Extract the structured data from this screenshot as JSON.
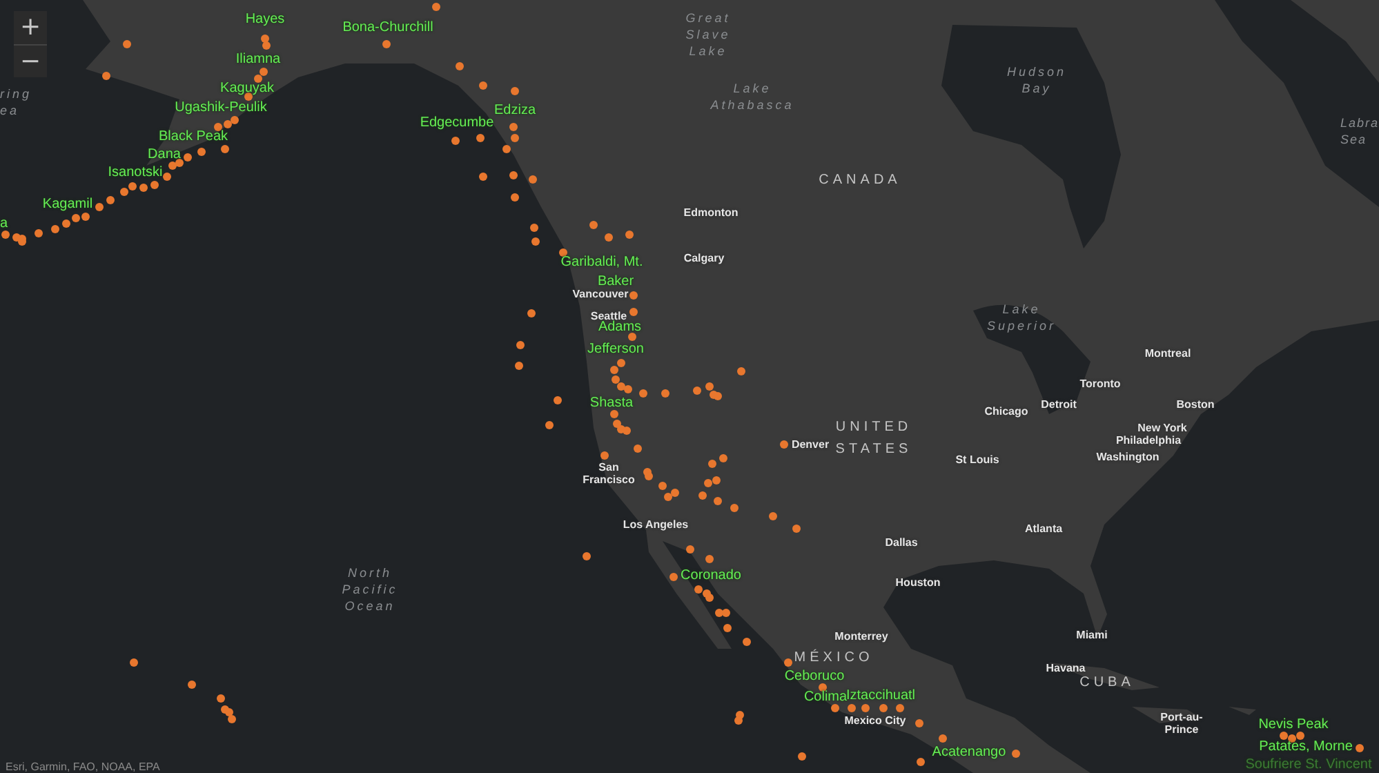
{
  "zoom_controls": [
    {
      "kind": "zoom-in",
      "symbol": "+"
    },
    {
      "kind": "zoom-out",
      "symbol": "−"
    }
  ],
  "volcano_labels": [
    "Hayes",
    "Bona-Churchill",
    "Iliamna",
    "Kaguyak",
    "Ugashik-Peulik",
    "Black Peak",
    "Dana",
    "Isanotski",
    "Kagamil",
    "a",
    "Edgecumbe",
    "Edziza",
    "Garibaldi, Mt.",
    "Baker",
    "Adams",
    "Jefferson",
    "Shasta",
    "Coronado",
    "Ceboruco",
    "Colima",
    "Iztaccihuatl",
    "Acatenango",
    "Nevis Peak",
    "Patates, Morne",
    "Soufriere St. Vincent"
  ],
  "city_labels": [
    "Edmonton",
    "Calgary",
    "Vancouver",
    "Seattle",
    "San\nFrancisco",
    "Los Angeles",
    "Denver",
    "Chicago",
    "St Louis",
    "Detroit",
    "Toronto",
    "Montreal",
    "Boston",
    "New York",
    "Philadelphia",
    "Washington",
    "Atlanta",
    "Dallas",
    "Houston",
    "Monterrey",
    "Miami",
    "Havana",
    "Mexico City",
    "Port-au-\nPrince"
  ],
  "country_labels": [
    "CANADA",
    "UNITED\nSTATES",
    "MÉXICO",
    "CUBA"
  ],
  "water_labels": [
    "ring\nea",
    "Great\nSlave\nLake",
    "Lake\nAthabasca",
    "Hudson\nBay",
    "Labra\nSea",
    "Lake\nSuperior",
    "North\nPacific\nOcean"
  ],
  "attribution": "Esri, Garmin, FAO, NOAA, EPA"
}
